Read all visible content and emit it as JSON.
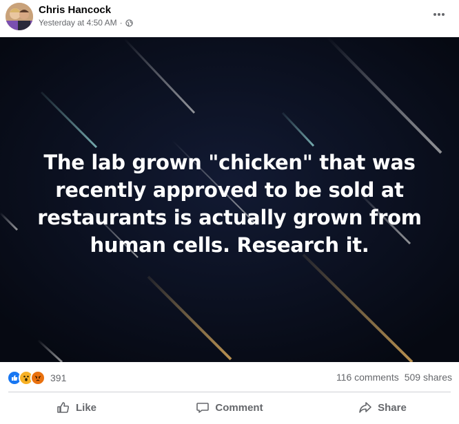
{
  "post": {
    "author": "Chris Hancock",
    "timestamp": "Yesterday at 4:50 AM",
    "separator": "·",
    "privacy_icon": "globe-icon",
    "more_icon": "more-options-icon"
  },
  "image": {
    "caption": "The lab grown \"chicken\" that was recently approved to be sold at restaurants is actually grown from human cells. Research it.",
    "background_color": "#0a0f1f"
  },
  "stats": {
    "reactions": [
      "like",
      "wow",
      "angry"
    ],
    "reaction_count": "391",
    "comments": "116 comments",
    "shares": "509 shares"
  },
  "actions": {
    "like": "Like",
    "comment": "Comment",
    "share": "Share"
  },
  "colors": {
    "like_blue": "#1877f2",
    "wow_yellow": "#f7b125",
    "angry_orange": "#e9710f",
    "secondary_text": "#65676b"
  }
}
